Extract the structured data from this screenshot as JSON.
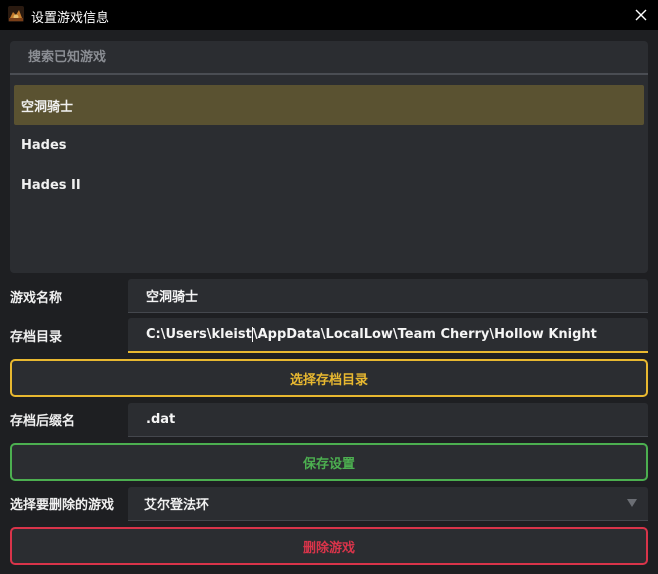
{
  "window": {
    "title": "设置游戏信息",
    "app_icon": "game-controller-icon",
    "close_icon": "close-icon"
  },
  "search": {
    "placeholder": "搜索已知游戏",
    "value": ""
  },
  "game_list": {
    "items": [
      {
        "label": "空洞骑士",
        "selected": true
      },
      {
        "label": "Hades",
        "selected": false
      },
      {
        "label": "Hades II",
        "selected": false
      }
    ]
  },
  "form": {
    "name_label": "游戏名称",
    "name_value": "空洞骑士",
    "save_dir_label": "存档目录",
    "save_dir_value_before_caret": "C:\\Users\\kleist",
    "save_dir_value_after_caret": "\\AppData\\LocalLow\\Team Cherry\\Hollow Knight",
    "choose_dir_button": "选择存档目录",
    "suffix_label": "存档后缀名",
    "suffix_value": ".dat",
    "save_button": "保存设置",
    "delete_select_label": "选择要删除的游戏",
    "delete_select_value": "艾尔登法环",
    "delete_button": "删除游戏"
  },
  "colors": {
    "background": "#1e1f22",
    "field": "#2b2d31",
    "selected_item": "#5a5231",
    "accent_yellow": "#e8b830",
    "accent_green": "#4caf50",
    "accent_red": "#d9344a"
  }
}
